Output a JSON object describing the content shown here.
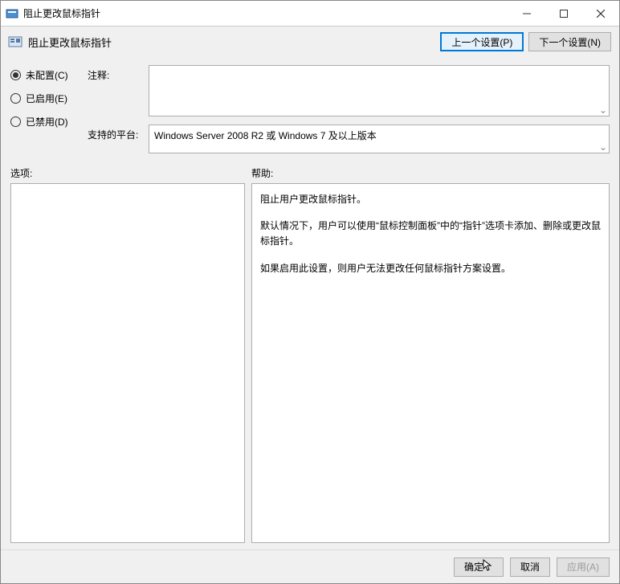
{
  "window": {
    "title": "阻止更改鼠标指针"
  },
  "header": {
    "title": "阻止更改鼠标指针",
    "prev_label": "上一个设置(P)",
    "next_label": "下一个设置(N)"
  },
  "radios": {
    "not_configured": "未配置(C)",
    "enabled": "已启用(E)",
    "disabled": "已禁用(D)"
  },
  "fields": {
    "comment_label": "注释:",
    "comment_value": "",
    "platform_label": "支持的平台:",
    "platform_value": "Windows Server 2008 R2 或 Windows 7 及以上版本"
  },
  "labels": {
    "options": "选项:",
    "help": "帮助:"
  },
  "help": {
    "p1": "阻止用户更改鼠标指针。",
    "p2": "默认情况下，用户可以使用“鼠标控制面板”中的“指针”选项卡添加、删除或更改鼠标指针。",
    "p3": "如果启用此设置，则用户无法更改任何鼠标指针方案设置。"
  },
  "footer": {
    "ok": "确定",
    "cancel": "取消",
    "apply": "应用(A)"
  }
}
